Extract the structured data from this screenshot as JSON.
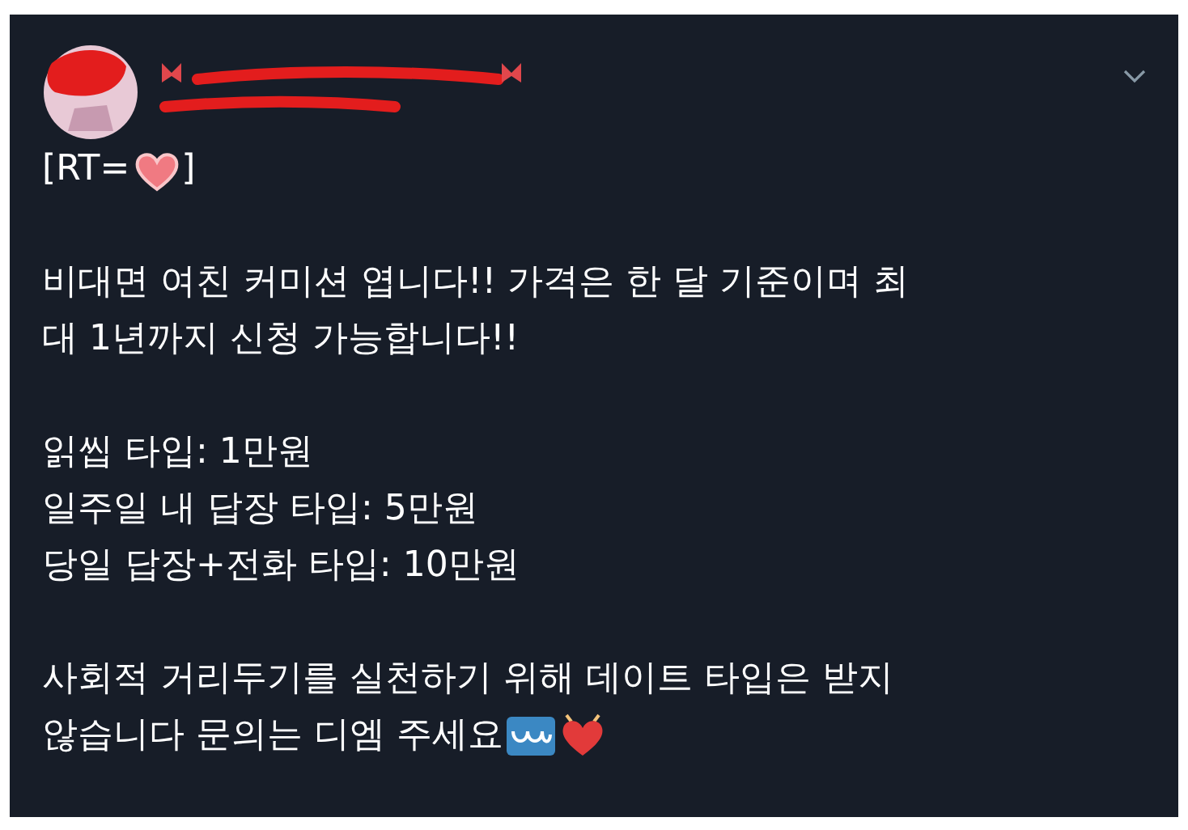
{
  "tweet": {
    "rt_prefix": "[RT=",
    "rt_suffix": "]",
    "paragraphs": [
      {
        "lines": [
          "비대면 여친 커미션 엽니다!! 가격은 한 달 기준이며 최",
          "대 1년까지 신청 가능합니다!!"
        ]
      },
      {
        "lines": [
          "읽씹 타입: 1만원",
          "일주일 내 답장 타입: 5만원",
          "당일 답장+전화 타입: 10만원"
        ]
      },
      {
        "lines": [
          "사회적 거리두기를 실천하기 위해 데이트 타입은 받지",
          "않습니다 문의는 디엠 주세요"
        ]
      }
    ]
  }
}
